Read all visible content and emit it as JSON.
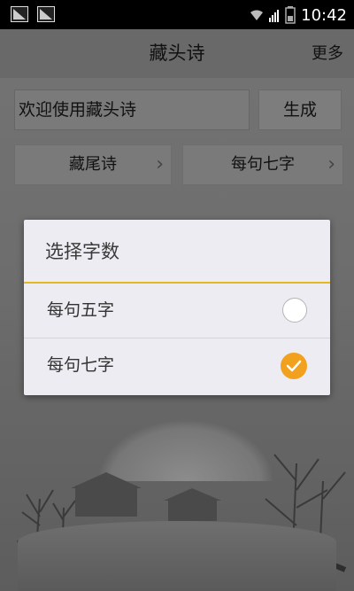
{
  "status_bar": {
    "time": "10:42",
    "icons": [
      "notification-icon",
      "notification-icon",
      "wifi-icon",
      "signal-icon",
      "battery-icon"
    ]
  },
  "header": {
    "title": "藏头诗",
    "more_label": "更多"
  },
  "input": {
    "value": "欢迎使用藏头诗"
  },
  "generate_label": "生成",
  "selectors": [
    {
      "label": "藏尾诗"
    },
    {
      "label": "每句七字"
    }
  ],
  "dialog": {
    "title": "选择字数",
    "options": [
      {
        "label": "每句五字",
        "selected": false
      },
      {
        "label": "每句七字",
        "selected": true
      }
    ],
    "accent_color": "#f2a11f",
    "divider_color": "#e6b820"
  }
}
